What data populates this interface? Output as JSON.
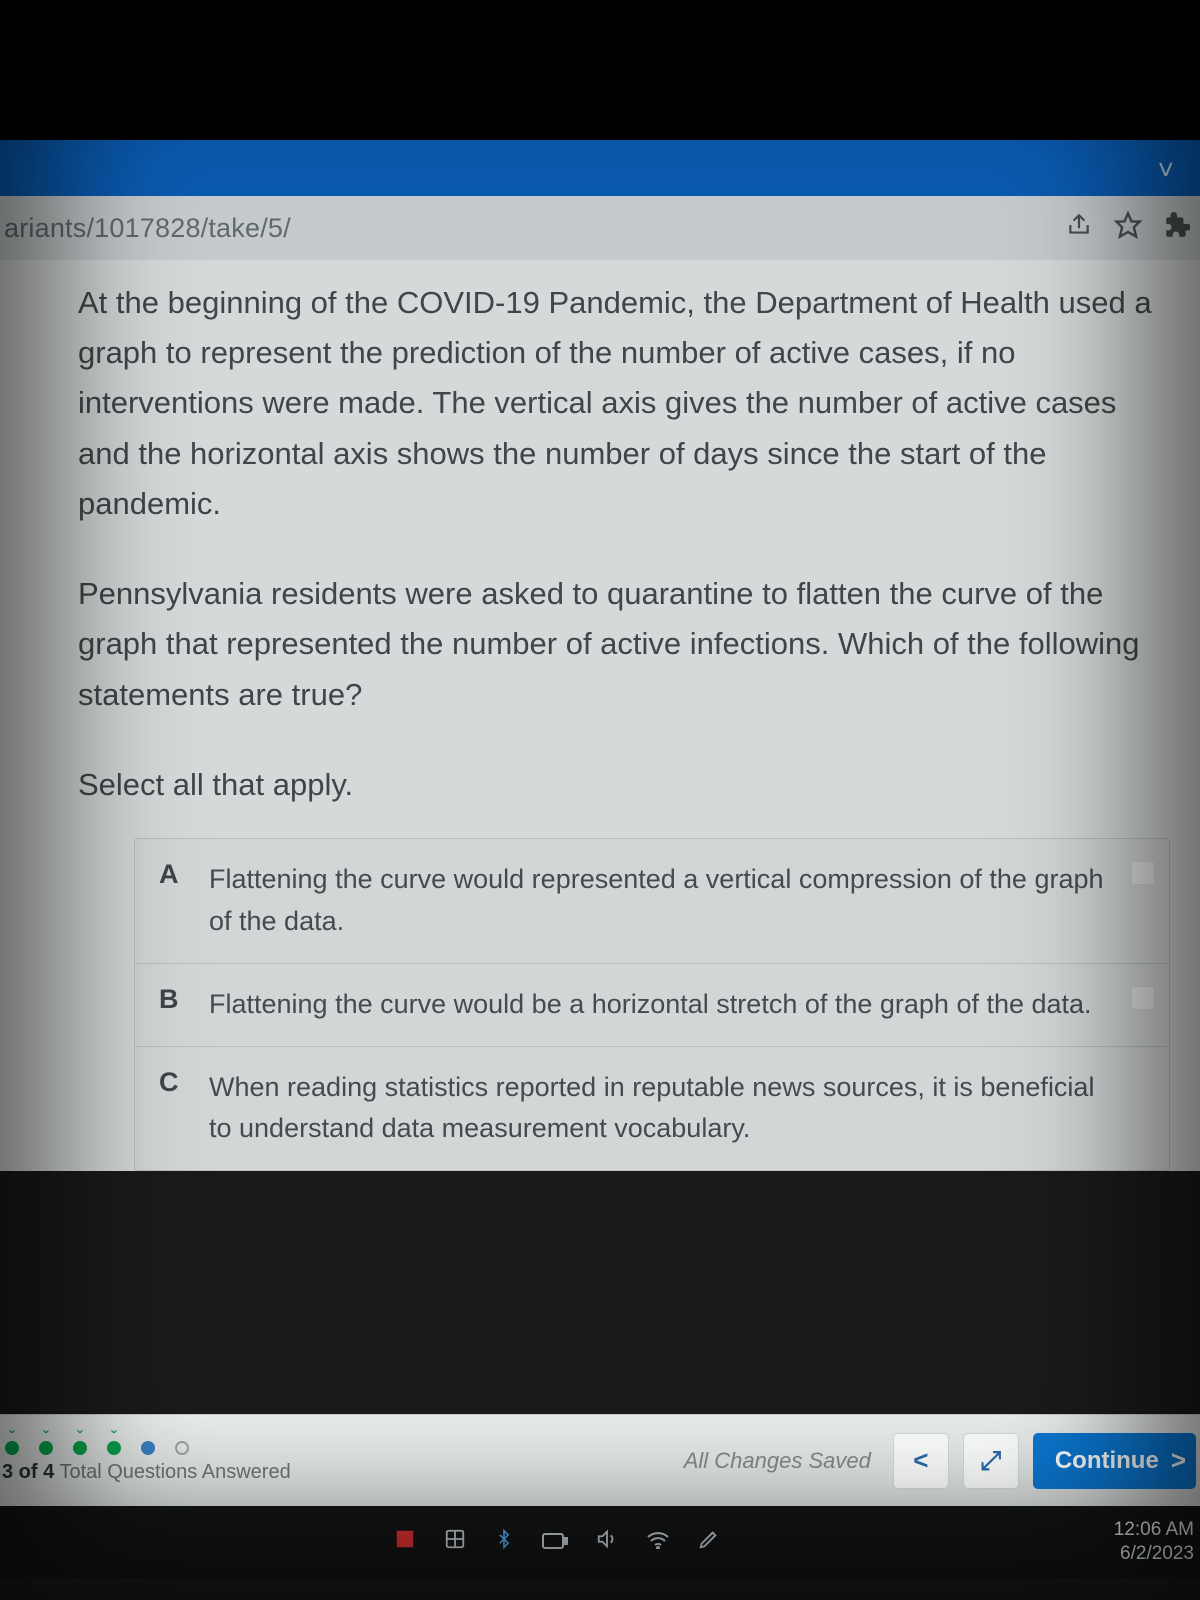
{
  "browser": {
    "url": "ariants/1017828/take/5/"
  },
  "question": {
    "p1": "At the beginning of the COVID-19 Pandemic, the Department of Health used a graph to represent the prediction of the number of active cases, if no interventions were made. The vertical axis gives the num­ber of active cases and the horizontal axis shows the number of days since the start of the pandemic.",
    "p2": "Pennsylvania residents were asked to quarantine to flatten the curve of the graph that represented the number of active infections. Which of the following statements are true?",
    "instruction": "Select all that apply."
  },
  "options": {
    "a": {
      "letter": "A",
      "text": "Flattening the curve would represented a vertical compression of the graph of the data."
    },
    "b": {
      "letter": "B",
      "text": "Flattening the curve would be a horizontal stretch of the graph of the data."
    },
    "c": {
      "letter": "C",
      "text": "When reading statistics reported in reputable news sources, it is ben­eficial to understand data measurement vocabulary."
    }
  },
  "footer": {
    "saved": "All Changes Saved",
    "continue": "Continue",
    "progress_bold": "3 of 4",
    "progress_rest": " Total Questions Answered"
  },
  "system": {
    "time": "12:06 AM",
    "date": "6/2/2023"
  }
}
